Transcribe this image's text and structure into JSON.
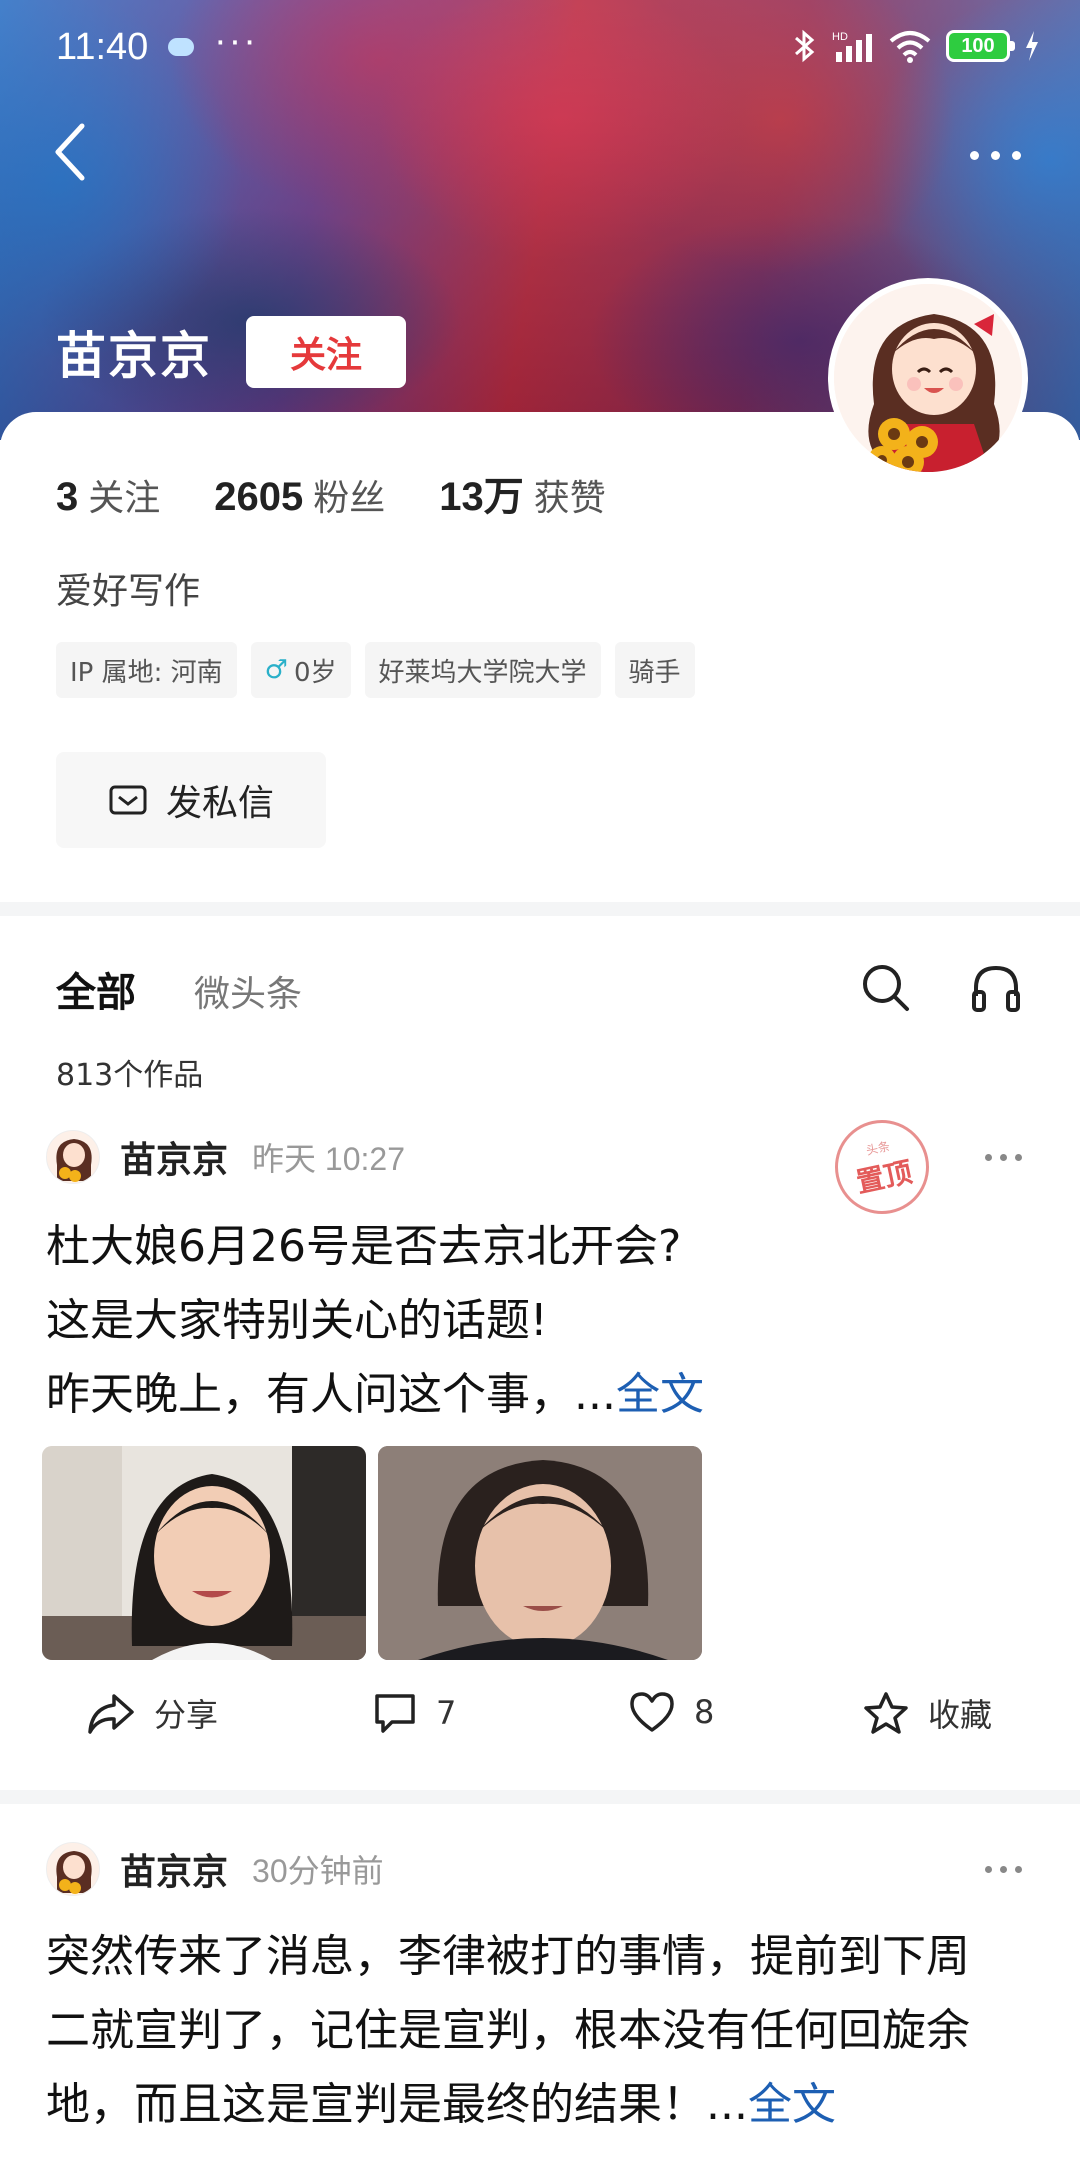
{
  "status_bar": {
    "time": "11:40",
    "battery": "100"
  },
  "profile": {
    "name": "苗京京",
    "follow_label": "关注",
    "stats": [
      {
        "num": "3",
        "label": "关注"
      },
      {
        "num": "2605",
        "label": "粉丝"
      },
      {
        "num": "13万",
        "label": "获赞"
      }
    ],
    "bio": "爱好写作",
    "tags": {
      "ip": "IP 属地: 河南",
      "age": "0岁",
      "school": "好莱坞大学院大学",
      "job": "骑手"
    },
    "dm_label": "发私信"
  },
  "tabs": {
    "all": "全部",
    "weitoutiao": "微头条"
  },
  "works_count": "813个作品",
  "posts": [
    {
      "author": "苗京京",
      "time": "昨天   10:27",
      "pinned_stamp_top": "头条",
      "pinned_stamp": "置顶",
      "lines": [
        "杜大娘6月26号是否去京北开会?",
        "这是大家特别关心的话题!",
        "昨天晚上，有人问这个事，..."
      ],
      "more": "全文",
      "actions": {
        "share": "分享",
        "comments": "7",
        "likes": "8",
        "collect": "收藏"
      }
    },
    {
      "author": "苗京京",
      "time": "30分钟前",
      "lines": [
        "突然传来了消息，李律被打的事情，提前到下周",
        "二就宣判了，记住是宣判，根本没有任何回旋余",
        "地，而且这是宣判是最终的结果！..."
      ],
      "more": "全文"
    }
  ],
  "colors": {
    "follow_red": "#e5393b",
    "link_blue": "#1d5fb3"
  }
}
